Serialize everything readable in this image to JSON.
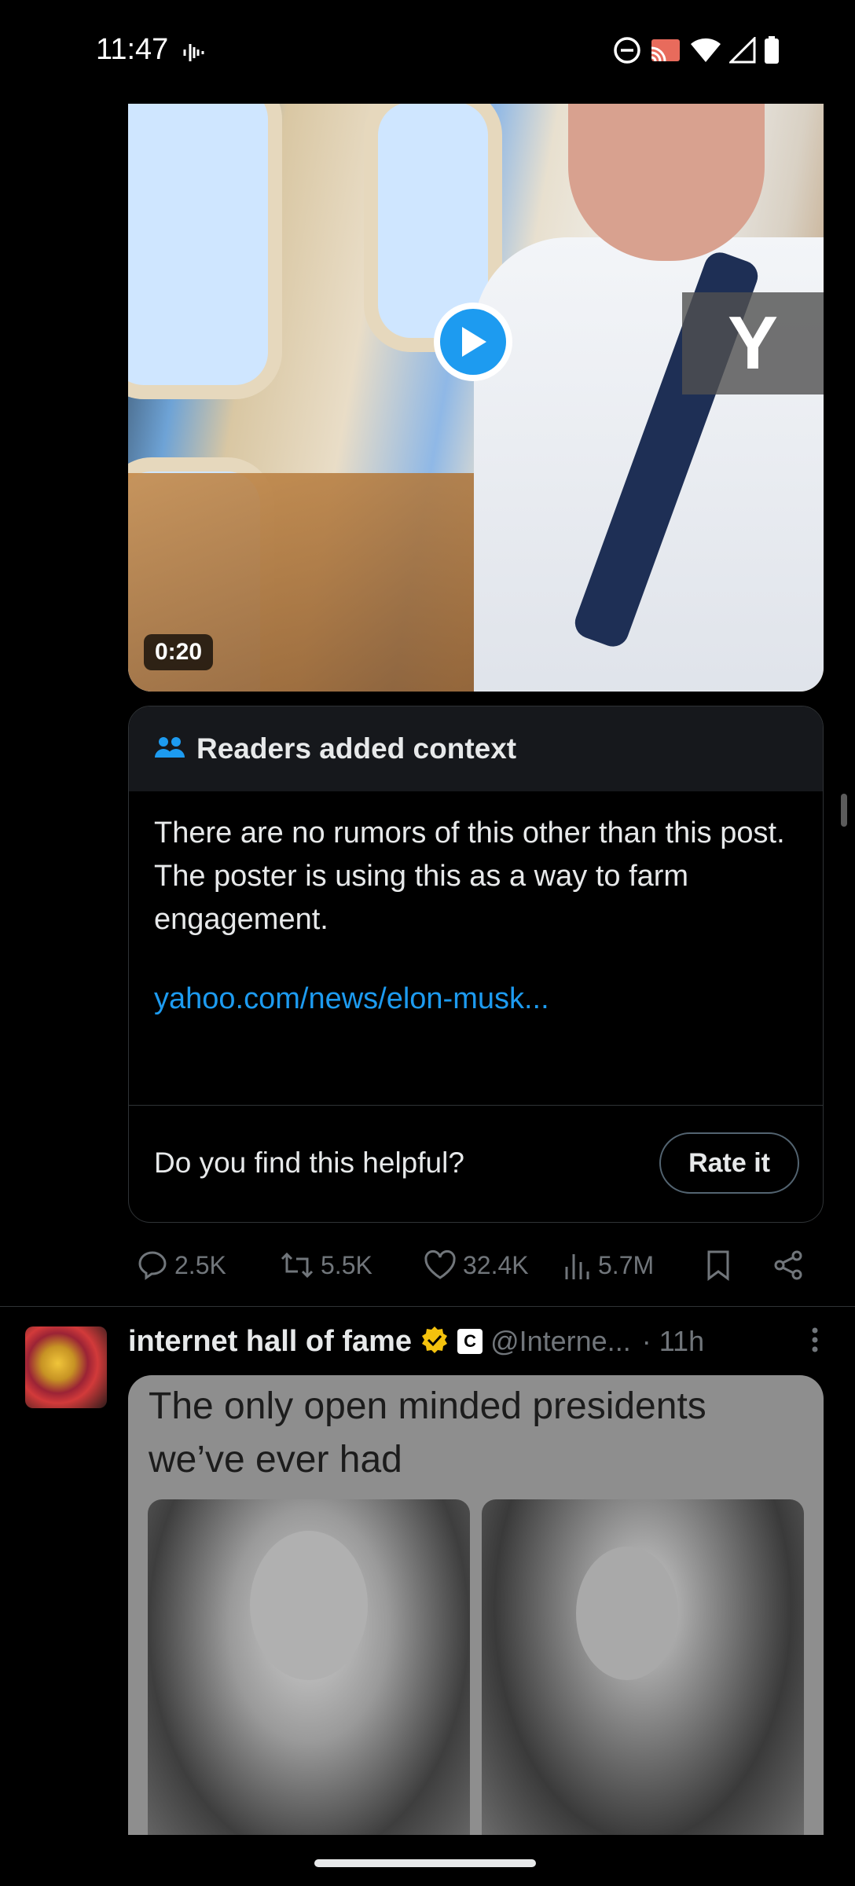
{
  "status_bar": {
    "time": "11:47",
    "icons": [
      "voice-activity-icon",
      "do-not-disturb-icon",
      "cast-icon",
      "wifi-icon",
      "signal-icon",
      "battery-icon"
    ]
  },
  "video": {
    "duration": "0:20",
    "overlay_text": "Y"
  },
  "community_note": {
    "header": "Readers added context",
    "text": "There are no rumors of this other than this post. The poster is using this as a way to farm engagement.",
    "link": "yahoo.com/news/elon-musk...",
    "question": "Do you find this helpful?",
    "rate_label": "Rate it"
  },
  "actions": {
    "replies": "2.5K",
    "reposts": "5.5K",
    "likes": "32.4K",
    "views": "5.7M"
  },
  "next_post": {
    "author_name": "internet hall of fame",
    "affiliate_badge": "C",
    "handle": "@Interne...",
    "time": "· 11h",
    "meme_caption_line1": "The only open minded presidents",
    "meme_caption_line2": "we’ve ever had"
  },
  "colors": {
    "accent": "#1d9bf0",
    "muted": "#71767b",
    "verified": "#f4c20d",
    "background": "#000000"
  }
}
